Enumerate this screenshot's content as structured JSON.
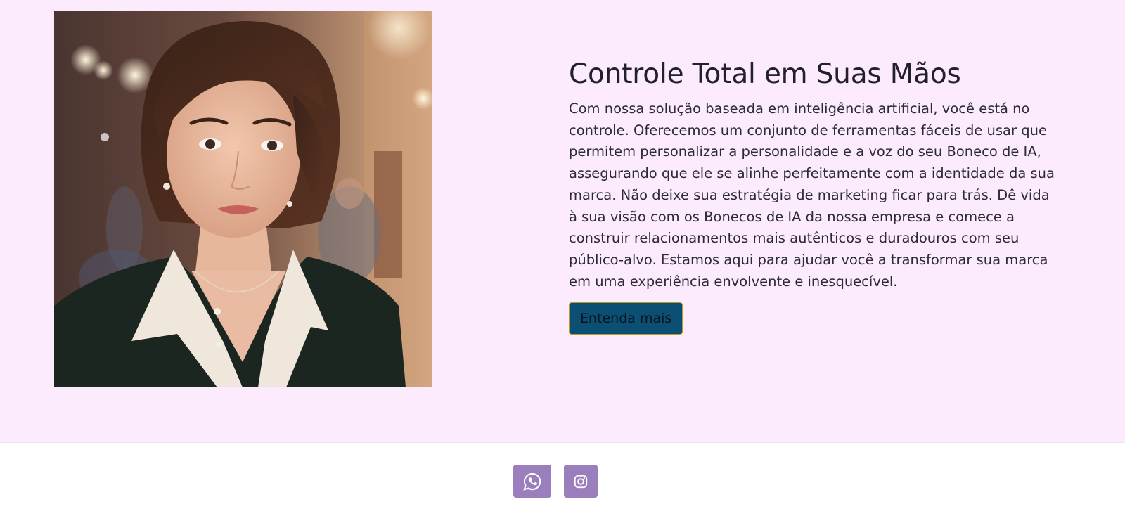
{
  "hero": {
    "image": {
      "alt": "",
      "icon": "portrait-photo"
    },
    "title": "Controle Total em Suas Mãos",
    "description": "Com nossa solução baseada em inteligência artificial, você está no controle. Oferecemos um conjunto de ferramentas fáceis de usar que permitem personalizar a personalidade e a voz do seu Boneco de IA, assegurando que ele se alinhe perfeitamente com a identidade da sua marca. Não deixe sua estratégia de marketing ficar para trás. Dê vida à sua visão com os Bonecos de IA da nossa empresa e comece a construir relacionamentos mais autênticos e duradouros com seu público-alvo. Estamos aqui para ajudar você a transformar sua marca em uma experiência envolvente e inesquecível.",
    "cta_label": "Entenda mais"
  },
  "footer": {
    "social": [
      {
        "icon": "whatsapp-icon"
      },
      {
        "icon": "instagram-icon"
      }
    ]
  },
  "colors": {
    "hero_background": "#fcebfd",
    "button_background": "#0b4f73",
    "button_border": "#b69a2a",
    "social_background": "#9b7fbd"
  }
}
